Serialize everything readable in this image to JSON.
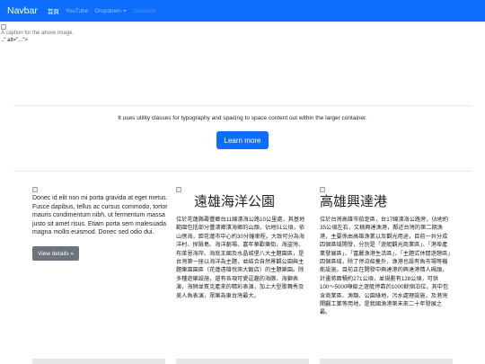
{
  "navbar": {
    "brand": "Navbar",
    "links": [
      {
        "label": "首頁",
        "state": "active"
      },
      {
        "label": "YouTube",
        "state": "normal"
      },
      {
        "label": "Dropdown",
        "state": "dropdown"
      },
      {
        "label": "Disabled",
        "state": "disabled"
      }
    ]
  },
  "top_image": {
    "caption": "A caption for the above image.",
    "broken_markup": "..\" alt=\"...\">"
  },
  "hero": {
    "lead_text": "It uses utility classes for typography and spacing to space content out within the larger container.",
    "button_label": "Learn more"
  },
  "columns": [
    {
      "text": "Donec id elit non mi porta gravida at eget metus. Fusce dapibus, tellus ac cursus commodo, tortor mauris condimentum nibh, ut fermentum massa justo sit amet risus. Etiam porta sem malesuada magna mollis euismod. Donec sed odio dui.",
      "button_label": "View details »"
    },
    {
      "title": "遠雄海洋公園",
      "body": "位於花蓮縣壽豐鄉台11線濱海公路10公里處，其基地範圍包括部分豐濱鄉濱海鄉的山頭，佔地51公頃，依山傍海，距花蓮市中心約30分鐘車程。大致可分為海洋村、探險島、海洋劇場、嘉年華歡樂街、海盜灣、布萊恩海岸、海底王國及水晶城堡八大主題園區，是台灣第一座以海洋為主題，並結合自然景觀公園與主題樂園園區（花蓮遠雄悅來大飯店）的主題樂園。除多種遊樂設施，還有各項可愛逗趣的海豚、海獅表演，海狮並賓克產來的精彩表演，加上大型歌舞秀及美人魚表演，眾樂為東台灣最大。"
    },
    {
      "title": "高雄興達港",
      "body": "位於台灣高雄市茄萣區，台17線濱海公路旁，佔地約35公頃左右，又稱興達漁港，鄰近台灣的第二期漁港，主要係由高雄漁業以及觀光用途，目前一共分成四個區域開發，分別是「遊艇觀光商業區」、「港埠產業發展區」、「富麗漁港生活區」、「主題式休閒遊憩區」四個區域，除了停泊船隻外，漁港也設有魚市場等機能設施。目前正在開發中興達港的興達港情人碼頭，計畫將面積約271公頃，並規劃有128公頃，可供100〜5000噸級之遊艇停靠的1000餘個泊位，其中包含商業區、漁類、公園綠地，污水處理設施，及港灣開闢工業等用地，是我國漁港第未來二十年發展之最。"
    }
  ]
}
